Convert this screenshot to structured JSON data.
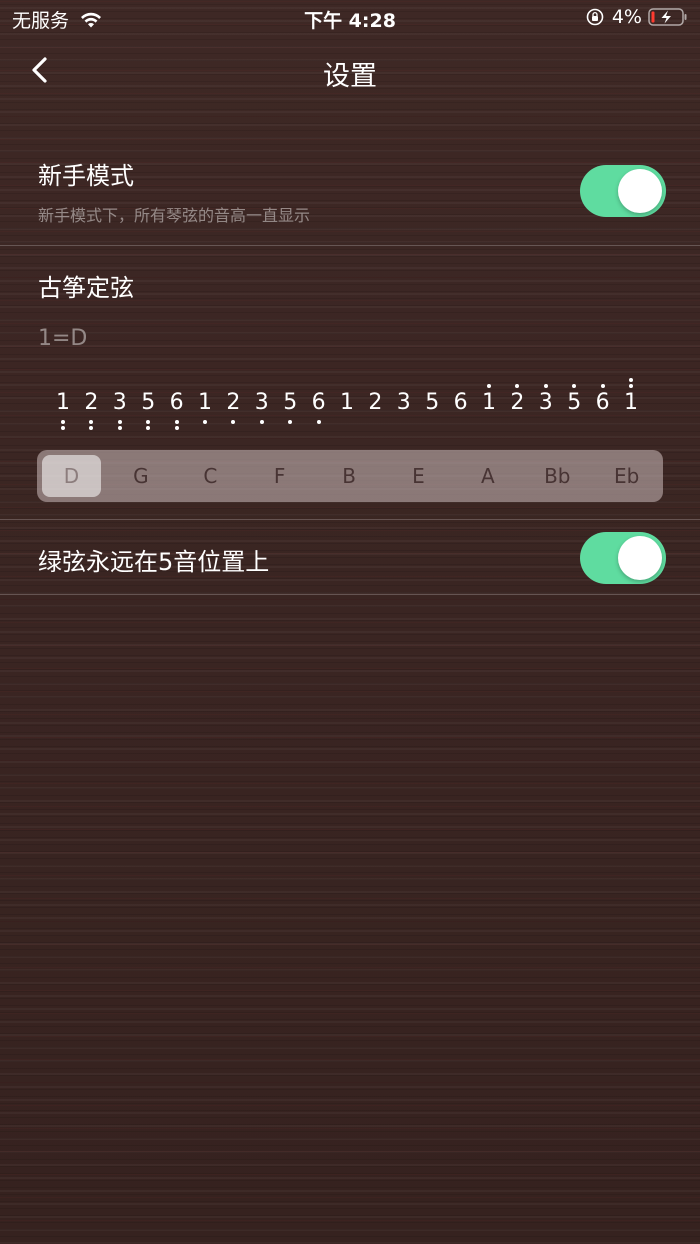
{
  "status_bar": {
    "carrier": "无服务",
    "time": "下午 4:28",
    "battery_percent": "4%"
  },
  "nav": {
    "title": "设置"
  },
  "beginner_mode": {
    "title": "新手模式",
    "subtitle": "新手模式下，所有琴弦的音高一直显示",
    "enabled": true
  },
  "tuning": {
    "title": "古筝定弦",
    "key_label": "1=D",
    "strings": [
      {
        "digit": "1",
        "below": 2,
        "above": 0
      },
      {
        "digit": "2",
        "below": 2,
        "above": 0
      },
      {
        "digit": "3",
        "below": 2,
        "above": 0
      },
      {
        "digit": "5",
        "below": 2,
        "above": 0
      },
      {
        "digit": "6",
        "below": 2,
        "above": 0
      },
      {
        "digit": "1",
        "below": 1,
        "above": 0
      },
      {
        "digit": "2",
        "below": 1,
        "above": 0
      },
      {
        "digit": "3",
        "below": 1,
        "above": 0
      },
      {
        "digit": "5",
        "below": 1,
        "above": 0
      },
      {
        "digit": "6",
        "below": 1,
        "above": 0
      },
      {
        "digit": "1",
        "below": 0,
        "above": 0
      },
      {
        "digit": "2",
        "below": 0,
        "above": 0
      },
      {
        "digit": "3",
        "below": 0,
        "above": 0
      },
      {
        "digit": "5",
        "below": 0,
        "above": 0
      },
      {
        "digit": "6",
        "below": 0,
        "above": 0
      },
      {
        "digit": "1",
        "below": 0,
        "above": 1
      },
      {
        "digit": "2",
        "below": 0,
        "above": 1
      },
      {
        "digit": "3",
        "below": 0,
        "above": 1
      },
      {
        "digit": "5",
        "below": 0,
        "above": 1
      },
      {
        "digit": "6",
        "below": 0,
        "above": 1
      },
      {
        "digit": "1",
        "below": 0,
        "above": 2
      }
    ],
    "keys": [
      "D",
      "G",
      "C",
      "F",
      "B",
      "E",
      "A",
      "Bb",
      "Eb"
    ],
    "selected_key": "D"
  },
  "green_string": {
    "title": "绿弦永远在5音位置上",
    "enabled": true
  },
  "colors": {
    "toggle_on": "#5fdca0"
  }
}
